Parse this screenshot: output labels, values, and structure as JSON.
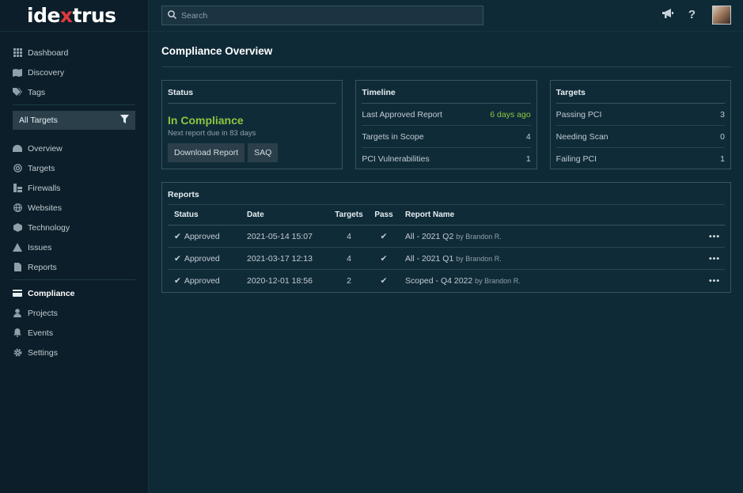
{
  "brand": {
    "part1": "ide",
    "x": "x",
    "part2": "trus"
  },
  "search": {
    "placeholder": "Search"
  },
  "sidebar": {
    "top": [
      {
        "label": "Dashboard",
        "icon": "grid-icon"
      },
      {
        "label": "Discovery",
        "icon": "map-icon"
      },
      {
        "label": "Tags",
        "icon": "tags-icon"
      }
    ],
    "target_filter": "All Targets",
    "mid": [
      {
        "label": "Overview",
        "icon": "gauge-icon"
      },
      {
        "label": "Targets",
        "icon": "target-icon"
      },
      {
        "label": "Firewalls",
        "icon": "firewall-icon"
      },
      {
        "label": "Websites",
        "icon": "globe-icon"
      },
      {
        "label": "Technology",
        "icon": "cube-icon"
      },
      {
        "label": "Issues",
        "icon": "warning-icon"
      },
      {
        "label": "Reports",
        "icon": "file-icon"
      }
    ],
    "bottom": [
      {
        "label": "Compliance",
        "icon": "card-icon"
      },
      {
        "label": "Projects",
        "icon": "user-icon"
      },
      {
        "label": "Events",
        "icon": "bell-icon"
      },
      {
        "label": "Settings",
        "icon": "gear-icon"
      }
    ]
  },
  "page": {
    "title": "Compliance Overview"
  },
  "status_card": {
    "title": "Status",
    "state": "In Compliance",
    "sub": "Next report due in 83 days",
    "download": "Download Report",
    "saq": "SAQ"
  },
  "timeline_card": {
    "title": "Timeline",
    "rows": [
      {
        "label": "Last Approved Report",
        "value": "6 days ago"
      },
      {
        "label": "Targets in Scope",
        "value": "4"
      },
      {
        "label": "PCI Vulnerabilities",
        "value": "1"
      }
    ]
  },
  "targets_card": {
    "title": "Targets",
    "rows": [
      {
        "label": "Passing PCI",
        "value": "3"
      },
      {
        "label": "Needing Scan",
        "value": "0"
      },
      {
        "label": "Failing PCI",
        "value": "1"
      }
    ]
  },
  "reports": {
    "title": "Reports",
    "columns": [
      "Status",
      "Date",
      "Targets",
      "Pass",
      "Report Name"
    ],
    "rows": [
      {
        "status": "Approved",
        "date": "2021-05-14 15:07",
        "targets": "4",
        "name": "All - 2021 Q2",
        "by": "by Brandon R."
      },
      {
        "status": "Approved",
        "date": "2021-03-17 12:13",
        "targets": "4",
        "name": "All - 2021 Q1",
        "by": "by Brandon R."
      },
      {
        "status": "Approved",
        "date": "2020-12-01 18:56",
        "targets": "2",
        "name": "Scoped - Q4 2022",
        "by": "by Brandon R."
      }
    ]
  },
  "colors": {
    "accent_green": "#8cc63f",
    "brand_red": "#e03b3b",
    "background": "#0f2a37",
    "sidebar": "#0b1e29"
  }
}
